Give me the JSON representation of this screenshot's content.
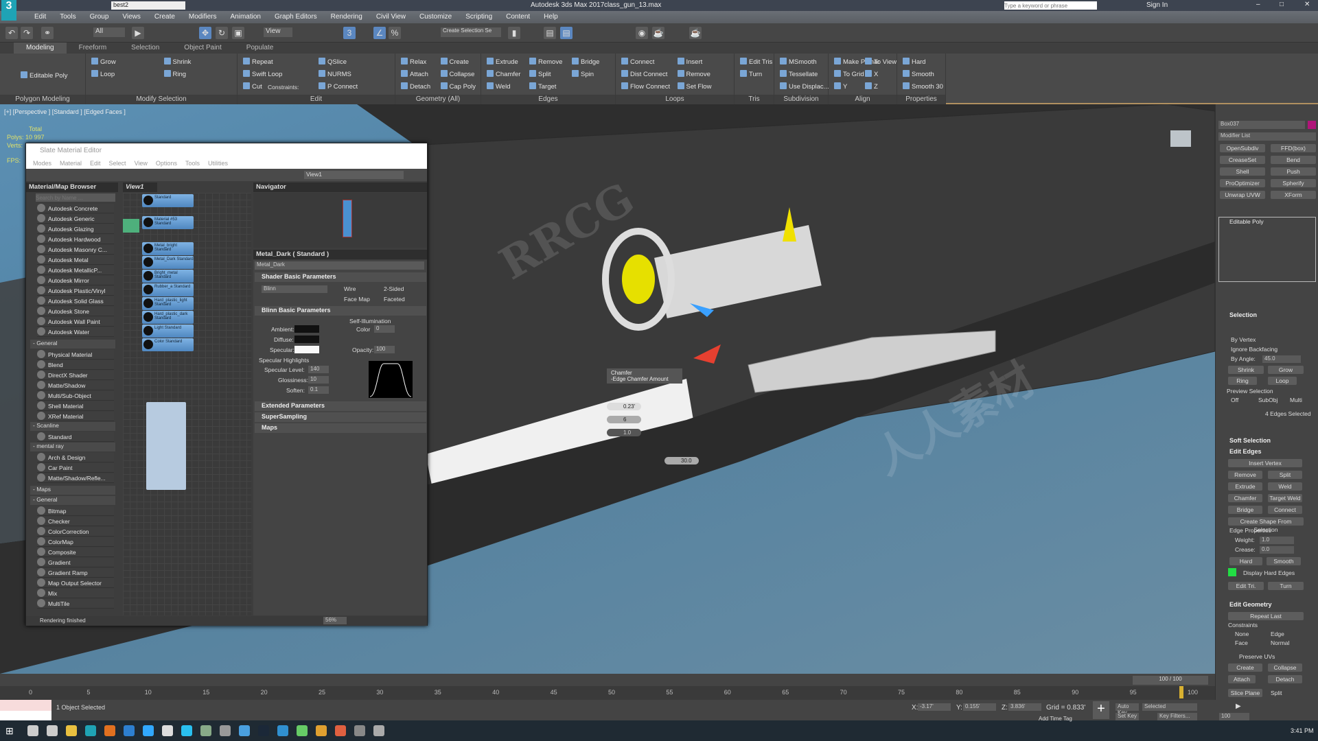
{
  "titlebar": {
    "quick_access_field": "best2",
    "app_title": "Autodesk 3ds Max 2017",
    "file_name": "class_gun_13.max",
    "search_placeholder": "Type a keyword or phrase",
    "sign_in": "Sign In"
  },
  "menu": [
    "Edit",
    "Tools",
    "Group",
    "Views",
    "Create",
    "Modifiers",
    "Animation",
    "Graph Editors",
    "Rendering",
    "Civil View",
    "Customize",
    "Scripting",
    "Content",
    "Help"
  ],
  "main_toolbar": {
    "selection_filter": "All",
    "reference_coord": "View",
    "named_selection": "Create Selection Se"
  },
  "ribbon_tabs": [
    "Modeling",
    "Freeform",
    "Selection",
    "Object Paint",
    "Populate"
  ],
  "ribbon": {
    "polygon_modeling": {
      "label": "Polygon Modeling",
      "object": "Editable Poly"
    },
    "modify_selection": {
      "label": "Modify Selection",
      "items": [
        "Grow",
        "Shrink",
        "Loop",
        "Ring"
      ]
    },
    "edit": {
      "label": "Edit",
      "items": [
        "Repeat",
        "QSlice",
        "Swift Loop",
        "NURMS",
        "Cut",
        "P Connect"
      ],
      "constraints": "Constraints:",
      "spinner": "1"
    },
    "geometry": {
      "label": "Geometry (All)",
      "items": [
        "Relax",
        "Create",
        "Attach",
        "Collapse",
        "Detach",
        "Cap Poly"
      ]
    },
    "edges": {
      "label": "Edges",
      "items": [
        "Extrude",
        "Remove",
        "Bridge",
        "Chamfer",
        "Split",
        "Spin",
        "Weld",
        "Target"
      ]
    },
    "loops": {
      "label": "Loops",
      "items": [
        "Connect",
        "Insert",
        "Dist Connect",
        "Remove",
        "Flow Connect",
        "Set Flow"
      ]
    },
    "tris": {
      "label": "Tris",
      "items": [
        "Edit Tris",
        "Turn"
      ]
    },
    "subdivision": {
      "label": "Subdivision",
      "items": [
        "MSmooth",
        "Tessellate",
        "Use Displac..."
      ]
    },
    "align": {
      "label": "Align",
      "items": [
        "Make Planar",
        "To View",
        "To Grid",
        "X",
        "Y",
        "Z"
      ]
    },
    "properties": {
      "label": "Properties",
      "items": [
        "Hard",
        "Smooth",
        "Smooth 30"
      ]
    }
  },
  "viewport": {
    "label": "[+] [Perspective ] [Standard ] [Edged Faces ]",
    "stats": {
      "total": "Total",
      "polys_label": "Polys:",
      "polys": "10 997",
      "verts_label": "Verts:",
      "fps_label": "FPS:"
    },
    "caddy": {
      "title": "Chamfer",
      "subtitle": "-Edge Chamfer Amount",
      "amount": "0.23'",
      "segments": "6",
      "tension": "1.0",
      "angle": "30.0"
    }
  },
  "slate": {
    "title": "Slate Material Editor",
    "menu": [
      "Modes",
      "Material",
      "Edit",
      "Select",
      "View",
      "Options",
      "Tools",
      "Utilities"
    ],
    "view_select": "View1",
    "browser": {
      "title": "Material/Map Browser",
      "search_placeholder": "Search by Name ...",
      "autodesk": [
        "Autodesk Concrete",
        "Autodesk Generic",
        "Autodesk Glazing",
        "Autodesk Hardwood",
        "Autodesk Masonry C...",
        "Autodesk Metal",
        "Autodesk MetallicP...",
        "Autodesk Mirror",
        "Autodesk Plastic/Vinyl",
        "Autodesk Solid Glass",
        "Autodesk Stone",
        "Autodesk Wall Paint",
        "Autodesk Water"
      ],
      "general_label": "- General",
      "general": [
        "Physical Material",
        "Blend",
        "DirectX Shader",
        "Matte/Shadow",
        "Multi/Sub-Object",
        "Shell Material",
        "XRef Material"
      ],
      "scanline_label": "- Scanline",
      "scanline": [
        "Standard"
      ],
      "mentalray_label": "- mental ray",
      "mentalray": [
        "Arch & Design",
        "Car Paint",
        "Matte/Shadow/Refle..."
      ],
      "maps_label": "- Maps",
      "maps_general_label": "- General",
      "maps": [
        "Bitmap",
        "Checker",
        "ColorCorrection",
        "ColorMap",
        "Composite",
        "Gradient",
        "Gradient Ramp",
        "Map Output Selector",
        "Mix",
        "MultiTile"
      ]
    },
    "view_tab": "View1",
    "nodes": [
      "Standard",
      "Material #53 Standard",
      "Metal_bright Standard",
      "Metal_Dark Standard",
      "Bright_metal Standard",
      "Rubber_a Standard",
      "Hard_plastic_light Standard",
      "Hard_plastic_dark Standard",
      "Light Standard",
      "Color Standard"
    ],
    "navigator": "Navigator",
    "params": {
      "header": "Metal_Dark  ( Standard )",
      "name": "Metal_Dark",
      "shader_rollout": "Shader Basic Parameters",
      "shader": "Blinn",
      "wire": "Wire",
      "two_sided": "2-Sided",
      "face_map": "Face Map",
      "faceted": "Faceted",
      "blinn_rollout": "Blinn Basic Parameters",
      "self_illum": "Self-Illumination",
      "color_label": "Color",
      "color_value": "0",
      "ambient": "Ambient:",
      "diffuse": "Diffuse:",
      "specular": "Specular:",
      "opacity_label": "Opacity:",
      "opacity": "100",
      "spec_highlights": "Specular Highlights",
      "spec_level_label": "Specular Level:",
      "spec_level": "140",
      "gloss_label": "Glossiness:",
      "gloss": "10",
      "soften_label": "Soften:",
      "soften": "0.1",
      "extended": "Extended Parameters",
      "supersampling": "SuperSampling",
      "maps": "Maps"
    },
    "status": "Rendering finished",
    "zoom": "56%"
  },
  "command_panel": {
    "object_name": "Box037",
    "object_color": "#b0157a",
    "modifier_list": "Modifier List",
    "modifier_buttons": [
      "OpenSubdiv",
      "FFD(box)",
      "CreaseSet",
      "Bend",
      "Shell",
      "Push",
      "ProOptimizer",
      "Spherify",
      "Unwrap UVW",
      "XForm"
    ],
    "stack": [
      "Editable Poly"
    ],
    "selection": {
      "title": "Selection",
      "by_vertex": "By Vertex",
      "ignore_backfacing": "Ignore Backfacing",
      "by_angle": "By Angle:",
      "angle": "45.0",
      "shrink": "Shrink",
      "grow": "Grow",
      "ring": "Ring",
      "loop": "Loop",
      "preview": "Preview Selection",
      "off": "Off",
      "subobj": "SubObj",
      "multi": "Multi",
      "count": "4 Edges Selected"
    },
    "soft_selection": "Soft Selection",
    "edit_edges": {
      "title": "Edit Edges",
      "insert_vertex": "Insert Vertex",
      "remove": "Remove",
      "split": "Split",
      "extrude": "Extrude",
      "weld": "Weld",
      "chamfer": "Chamfer",
      "target_weld": "Target Weld",
      "bridge": "Bridge",
      "connect": "Connect",
      "create_shape": "Create Shape From Selection",
      "edge_props": "Edge Properties",
      "weight_label": "Weight:",
      "weight": "1.0",
      "crease_label": "Crease:",
      "crease": "0.0",
      "hard": "Hard",
      "smooth": "Smooth",
      "display_hard": "Display Hard Edges",
      "edit_tri": "Edit Tri.",
      "turn": "Turn",
      "hard_edge_color": "#22dd44"
    },
    "edit_geometry": {
      "title": "Edit Geometry",
      "repeat_last": "Repeat Last",
      "constraints": "Constraints",
      "none": "None",
      "edge": "Edge",
      "face": "Face",
      "normal": "Normal",
      "preserve_uvs": "Preserve UVs",
      "create": "Create",
      "collapse": "Collapse",
      "attach": "Attach",
      "detach": "Detach",
      "slice_plane": "Slice Plane",
      "split": "Split"
    }
  },
  "timeline": {
    "frame": "100 / 100",
    "ticks": [
      "0",
      "5",
      "10",
      "15",
      "20",
      "25",
      "30",
      "35",
      "40",
      "45",
      "50",
      "55",
      "60",
      "65",
      "70",
      "75",
      "80",
      "85",
      "90",
      "95",
      "100"
    ]
  },
  "status": {
    "selection": "1 Object Selected",
    "x_label": "X:",
    "x": "-3.17'",
    "y_label": "Y:",
    "y": "0.155'",
    "z_label": "Z:",
    "z": "3.836'",
    "grid": "Grid = 0.833'",
    "add_time_tag": "Add Time Tag",
    "auto_key": "Auto Key",
    "selected": "Selected",
    "set_key": "Set Key",
    "key_filters": "Key Filters...",
    "frame": "100"
  },
  "taskbar": {
    "clock": "3:41 PM"
  },
  "watermarks": [
    "RRCG",
    "人人素材"
  ]
}
